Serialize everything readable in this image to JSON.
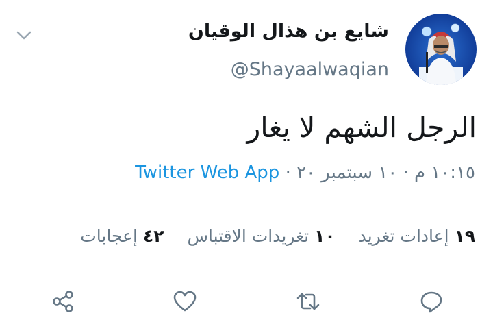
{
  "tweet": {
    "author_name": "شايع بن هذال الوقيان",
    "author_handle": "@Shayaalwaqian",
    "text": "الرجل الشهم لا يغار",
    "time": "١٠:١٥ م",
    "date": "١٠ سبتمبر ٢٠",
    "separator": "·",
    "source_app": "Twitter Web App"
  },
  "stats": {
    "retweets_count": "١٩",
    "retweets_label": "إعادات تغريد",
    "quotes_count": "١٠",
    "quotes_label": "تغريدات الاقتباس",
    "likes_count": "٤٢",
    "likes_label": "إعجابات"
  },
  "icons": {
    "menu": "chevron-down-icon",
    "reply": "reply-icon",
    "retweet": "retweet-icon",
    "like": "heart-icon",
    "share": "share-icon"
  },
  "colors": {
    "link": "#1b95e0",
    "secondary_text": "#657786",
    "icon": "#657786"
  }
}
